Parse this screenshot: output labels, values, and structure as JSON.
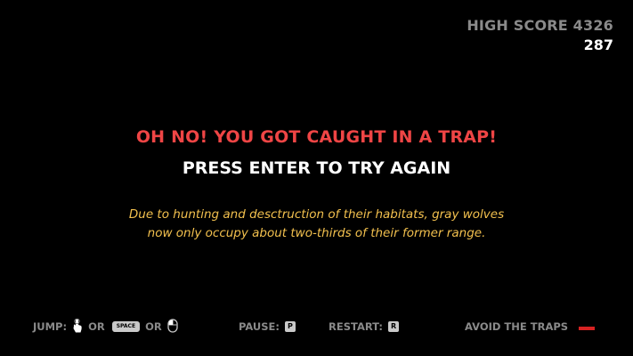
{
  "hud": {
    "high_score_label": "HIGH SCORE 4326",
    "score": "287"
  },
  "message": {
    "title": "OH NO! YOU GOT CAUGHT IN A TRAP!",
    "prompt": "PRESS ENTER TO TRY AGAIN",
    "fact_line1": "Due to hunting and desctruction of their habitats, gray wolves",
    "fact_line2": "now only occupy about two-thirds of their former range."
  },
  "controls": {
    "jump_label": "JUMP:",
    "or1": "OR",
    "space_key": "SPACE",
    "or2": "OR",
    "pause_label": "PAUSE:",
    "pause_key": "P",
    "restart_label": "RESTART:",
    "restart_key": "R",
    "objective": "AVOID THE TRAPS"
  },
  "icons": {
    "tap": "hand-pointer-icon",
    "mouse": "mouse-icon",
    "trap": "trap-marker"
  },
  "colors": {
    "background": "#000000",
    "title": "#ef4545",
    "prompt": "#ffffff",
    "fact": "#f2c04e",
    "muted": "#8a8a8a",
    "trap": "#d62222"
  }
}
